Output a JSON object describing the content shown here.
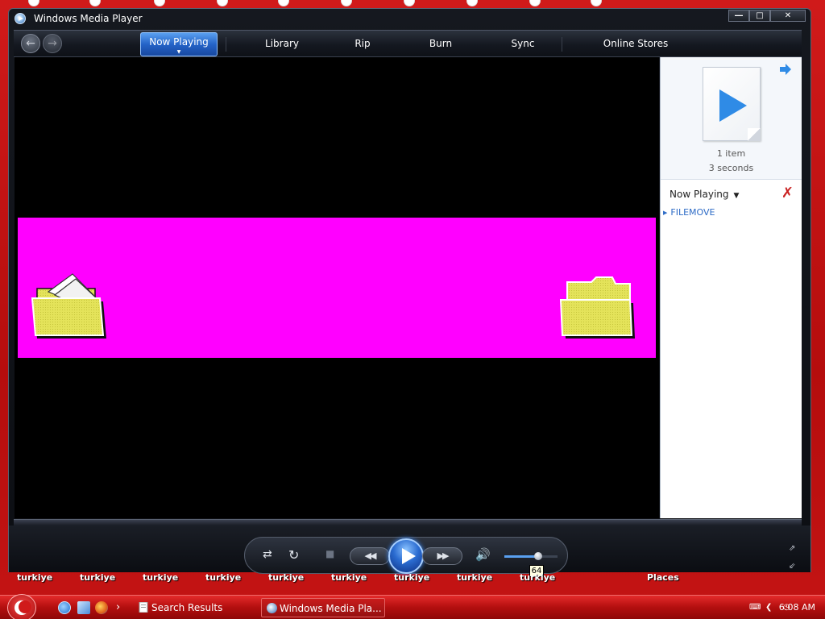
{
  "window": {
    "title": "Windows Media Player",
    "minimize_glyph": "―",
    "maximize_glyph": "□",
    "close_glyph": "✕"
  },
  "nav": {
    "back_icon": "back-arrow-icon",
    "forward_icon": "forward-arrow-icon",
    "tabs": [
      {
        "label": "Now Playing",
        "active": true
      },
      {
        "label": "Library"
      },
      {
        "label": "Rip"
      },
      {
        "label": "Burn"
      },
      {
        "label": "Sync"
      },
      {
        "label": "Online Stores"
      }
    ]
  },
  "video": {
    "background": "#000000",
    "visualization_color": "#ff00ff"
  },
  "panel": {
    "item_count": "1 item",
    "duration": "3 seconds",
    "list_title": "Now Playing",
    "items": [
      {
        "label": "FILEMOVE"
      }
    ]
  },
  "controls": {
    "volume_tooltip": "64",
    "volume_level": 64,
    "accent": "#2a6bd0"
  },
  "desktop": {
    "icon_labels": [
      "turkiye",
      "turkiye",
      "turkiye",
      "turkiye",
      "turkiye",
      "turkiye",
      "turkiye",
      "turkiye",
      "turkiye",
      "Places"
    ]
  },
  "taskbar": {
    "items": [
      {
        "label": "Search Results"
      },
      {
        "label": "Windows Media Pla...",
        "active": true
      }
    ],
    "clock": "6:08 AM",
    "chevron_glyph": "›"
  }
}
